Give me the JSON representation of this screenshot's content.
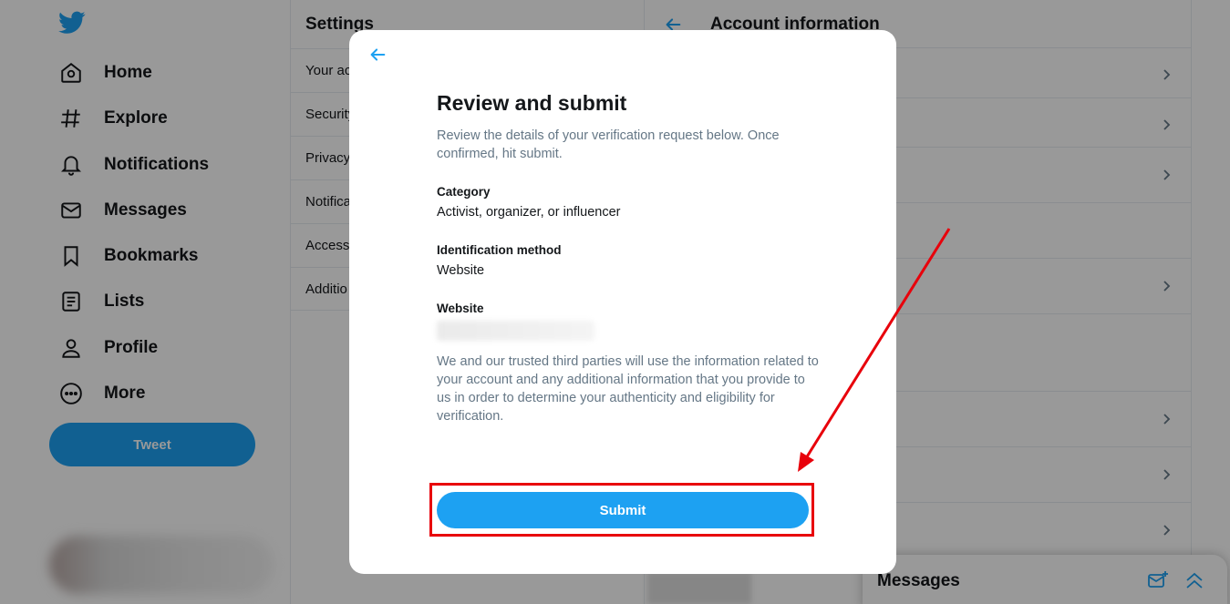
{
  "nav": {
    "items": [
      {
        "label": "Home",
        "icon": "home-icon"
      },
      {
        "label": "Explore",
        "icon": "hashtag-icon"
      },
      {
        "label": "Notifications",
        "icon": "bell-icon"
      },
      {
        "label": "Messages",
        "icon": "envelope-icon"
      },
      {
        "label": "Bookmarks",
        "icon": "bookmark-icon"
      },
      {
        "label": "Lists",
        "icon": "list-icon"
      },
      {
        "label": "Profile",
        "icon": "person-icon"
      },
      {
        "label": "More",
        "icon": "more-circle-icon"
      }
    ],
    "tweet_label": "Tweet"
  },
  "settings": {
    "title": "Settings",
    "items": [
      "Your ac",
      "Security",
      "Privacy",
      "Notifica",
      "Accessi",
      "Additio"
    ]
  },
  "account_info": {
    "title": "Account information"
  },
  "messages_drawer": {
    "title": "Messages"
  },
  "modal": {
    "title": "Review and submit",
    "description": "Review the details of your verification request below. Once confirmed, hit submit.",
    "fields": [
      {
        "label": "Category",
        "value": "Activist, organizer, or influencer"
      },
      {
        "label": "Identification method",
        "value": "Website"
      },
      {
        "label": "Website",
        "value": ""
      }
    ],
    "disclaimer": "We and our trusted third parties will use the information related to your account and any additional information that you provide to us in order to determine your authenticity and eligibility for verification.",
    "submit_label": "Submit"
  },
  "colors": {
    "accent": "#1da1f2",
    "annotation": "#e8000b",
    "muted_text": "#657786"
  }
}
